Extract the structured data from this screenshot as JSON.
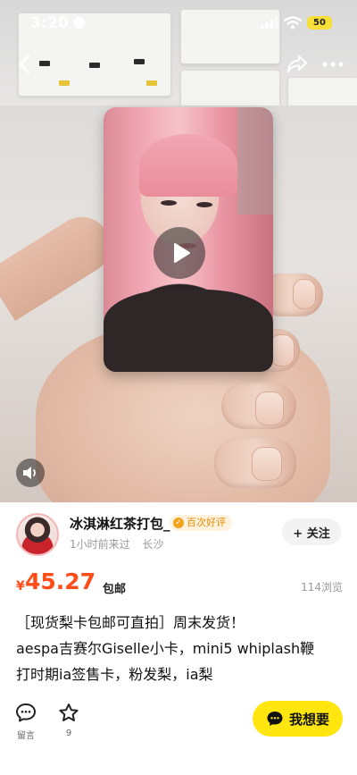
{
  "status_bar": {
    "time": "3:20",
    "battery": "50"
  },
  "media": {
    "has_video": true
  },
  "seller": {
    "name": "冰淇淋红茶打包_",
    "badge": "百次好评",
    "last_active": "1小时前来过",
    "location": "长沙",
    "follow_label": "+ 关注"
  },
  "price": {
    "currency": "¥",
    "amount": "45.27",
    "shipping": "包邮",
    "views": "114浏览"
  },
  "description": {
    "line1": "［现货梨卡包邮可直拍］周末发货！",
    "line2": "aespa吉赛尔Giselle小卡，mini5 whiplash鞭",
    "line3": "打时期ia签售卡，粉发梨，ia梨"
  },
  "actions": {
    "comment_label": "留言",
    "favorite_count": "9",
    "want_label": "我想要"
  },
  "colors": {
    "price": "#ff4d19",
    "want_button": "#ffe60f",
    "badge_text": "#e68a00"
  },
  "icons": [
    "back-icon",
    "share-icon",
    "more-icon",
    "play-icon",
    "speaker-icon",
    "comment-icon",
    "star-icon",
    "chat-icon"
  ]
}
